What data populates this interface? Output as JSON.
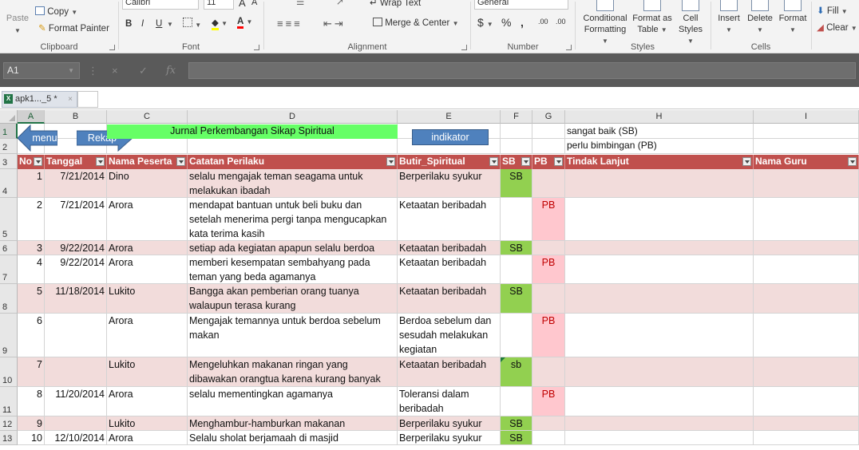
{
  "ribbon": {
    "clipboard": {
      "paste": "Paste",
      "copy": "Copy",
      "format_painter": "Format Painter",
      "label": "Clipboard"
    },
    "font": {
      "name": "Calibri",
      "size": "11",
      "bold": "B",
      "italic": "I",
      "underline": "U",
      "grow": "A",
      "shrink": "A",
      "font_color": "A",
      "label": "Font"
    },
    "alignment": {
      "wrap_text": "Wrap Text",
      "merge_center": "Merge & Center",
      "label": "Alignment"
    },
    "number": {
      "format": "General",
      "currency": "$",
      "percent": "%",
      "comma": ",",
      "inc_decimal": ".00",
      "dec_decimal": ".00",
      "label": "Number"
    },
    "styles": {
      "conditional": "Conditional",
      "formatting": "Formatting",
      "format_as": "Format as",
      "table": "Table",
      "cell": "Cell",
      "styles": "Styles",
      "label": "Styles"
    },
    "cells": {
      "insert": "Insert",
      "delete": "Delete",
      "format": "Format",
      "label": "Cells"
    },
    "editing": {
      "fill": "Fill",
      "clear": "Clear"
    }
  },
  "formula_bar": {
    "name_box": "A1",
    "fx": "fx",
    "cancel": "×",
    "enter": "✓",
    "value": ""
  },
  "workbook_tab": {
    "name": "apk1..._5 *",
    "close": "×"
  },
  "columns": [
    "A",
    "B",
    "C",
    "D",
    "E",
    "F",
    "G",
    "H",
    "I"
  ],
  "shapes": {
    "menu_label": "menu",
    "rekap_label": "Rekap",
    "title": "Jurnal Perkembangan Sikap Spiritual",
    "indikator_label": "indikator",
    "legend_sb": "sangat baik (SB)",
    "legend_pb": "perlu bimbingan (PB)",
    "accent_blue": "#4f81bd"
  },
  "table": {
    "headers": [
      "No",
      "Tanggal",
      "Nama Peserta",
      "Catatan Perilaku",
      "Butir_Spiritual",
      "SB",
      "PB",
      "Tindak Lanjut",
      "Nama Guru"
    ],
    "header_color": "#c0504d",
    "rows": [
      {
        "row": "4",
        "no": "1",
        "date": "7/21/2014",
        "name": "Dino",
        "note_lines": [
          "selalu mengajak teman seagama untuk",
          "melakukan ibadah"
        ],
        "butir_lines": [
          "Berperilaku syukur"
        ],
        "sb": "SB",
        "pb": ""
      },
      {
        "row": "5",
        "no": "2",
        "date": "7/21/2014",
        "name": "Arora",
        "note_lines": [
          "mendapat bantuan untuk beli buku dan",
          "setelah menerima pergi tanpa mengucapkan",
          "kata terima kasih"
        ],
        "butir_lines": [
          "Ketaatan beribadah"
        ],
        "sb": "",
        "pb": "PB"
      },
      {
        "row": "6",
        "no": "3",
        "date": "9/22/2014",
        "name": "Arora",
        "note_lines": [
          "setiap ada kegiatan apapun selalu berdoa"
        ],
        "butir_lines": [
          "Ketaatan beribadah"
        ],
        "sb": "SB",
        "pb": ""
      },
      {
        "row": "7",
        "no": "4",
        "date": "9/22/2014",
        "name": "Arora",
        "note_lines": [
          "memberi kesempatan sembahyang pada",
          "teman yang beda agamanya"
        ],
        "butir_lines": [
          "Ketaatan beribadah"
        ],
        "sb": "",
        "pb": "PB"
      },
      {
        "row": "8",
        "no": "5",
        "date": "11/18/2014",
        "name": "Lukito",
        "note_lines": [
          "Bangga akan pemberian orang tuanya",
          "walaupun terasa kurang"
        ],
        "butir_lines": [
          "Ketaatan beribadah"
        ],
        "sb": "SB",
        "pb": ""
      },
      {
        "row": "9",
        "no": "6",
        "date": "",
        "name": "Arora",
        "note_lines": [
          "Mengajak temannya untuk berdoa sebelum",
          "makan"
        ],
        "butir_lines": [
          "Berdoa sebelum dan",
          "sesudah melakukan",
          "kegiatan"
        ],
        "sb": "",
        "pb": "PB"
      },
      {
        "row": "10",
        "no": "7",
        "date": "",
        "name": "Lukito",
        "note_lines": [
          "Mengeluhkan makanan ringan yang",
          "dibawakan orangtua karena kurang banyak"
        ],
        "butir_lines": [
          "Ketaatan beribadah"
        ],
        "sb": "sb",
        "pb": ""
      },
      {
        "row": "11",
        "no": "8",
        "date": "11/20/2014",
        "name": "Arora",
        "note_lines": [
          "selalu mementingkan agamanya"
        ],
        "butir_lines": [
          "Toleransi dalam",
          "beribadah"
        ],
        "sb": "",
        "pb": "PB"
      },
      {
        "row": "12",
        "no": "9",
        "date": "",
        "name": "Lukito",
        "note_lines": [
          "Menghambur-hamburkan makanan"
        ],
        "butir_lines": [
          "Berperilaku syukur"
        ],
        "sb": "SB",
        "pb": ""
      },
      {
        "row": "13",
        "no": "10",
        "date": "12/10/2014",
        "name": "Arora",
        "note_lines": [
          "Selalu sholat berjamaah di masjid"
        ],
        "butir_lines": [
          "Berperilaku syukur"
        ],
        "sb": "SB",
        "pb": ""
      }
    ]
  }
}
